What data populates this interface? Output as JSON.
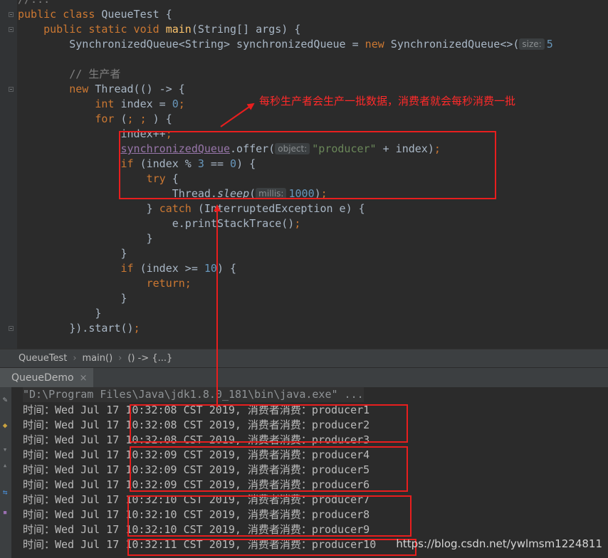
{
  "editor": {
    "lines": [
      [
        [
          "cm",
          "//..."
        ]
      ],
      [
        [
          "kw",
          "public class "
        ],
        [
          "p",
          "QueueTest {"
        ]
      ],
      [
        [
          "p",
          "    "
        ],
        [
          "kw",
          "public static void "
        ],
        [
          "fn",
          "main"
        ],
        [
          "p",
          "(String[] args) {"
        ]
      ],
      [
        [
          "p",
          "        SynchronizedQueue<String> synchronizedQueue = "
        ],
        [
          "kw",
          "new "
        ],
        [
          "p",
          "SynchronizedQueue<>("
        ],
        [
          "hint",
          "size:"
        ],
        [
          "num",
          "5"
        ]
      ],
      [
        [
          "p",
          ""
        ]
      ],
      [
        [
          "cm",
          "        // 生产者"
        ]
      ],
      [
        [
          "kw",
          "        new "
        ],
        [
          "p",
          "Thread(() -> {"
        ]
      ],
      [
        [
          "kw",
          "            int "
        ],
        [
          "p",
          "index = "
        ],
        [
          "num",
          "0"
        ],
        [
          "kw",
          ";"
        ]
      ],
      [
        [
          "kw",
          "            for "
        ],
        [
          "p",
          "("
        ],
        [
          "kw",
          "; ; "
        ],
        [
          "p",
          ") {"
        ]
      ],
      [
        [
          "p",
          "                index++"
        ],
        [
          "kw",
          ";"
        ]
      ],
      [
        [
          "p",
          "                "
        ],
        [
          "field",
          "synchronizedQueue"
        ],
        [
          "p",
          ".offer("
        ],
        [
          "hint",
          "object:"
        ],
        [
          "str",
          "\"producer\""
        ],
        [
          "p",
          " + index)"
        ],
        [
          "kw",
          ";"
        ]
      ],
      [
        [
          "kw",
          "                if "
        ],
        [
          "p",
          "(index % "
        ],
        [
          "num",
          "3"
        ],
        [
          "p",
          " == "
        ],
        [
          "num",
          "0"
        ],
        [
          "p",
          ") {"
        ]
      ],
      [
        [
          "kw",
          "                    try "
        ],
        [
          "p",
          "{"
        ]
      ],
      [
        [
          "p",
          "                        Thread."
        ],
        [
          "it",
          "sleep"
        ],
        [
          "p",
          "("
        ],
        [
          "hint",
          "millis:"
        ],
        [
          "num",
          "1000"
        ],
        [
          "p",
          ")"
        ],
        [
          "kw",
          ";"
        ]
      ],
      [
        [
          "p",
          "                    } "
        ],
        [
          "kw",
          "catch "
        ],
        [
          "p",
          "(InterruptedException e) {"
        ]
      ],
      [
        [
          "p",
          "                        e.printStackTrace()"
        ],
        [
          "kw",
          ";"
        ]
      ],
      [
        [
          "p",
          "                    }"
        ]
      ],
      [
        [
          "p",
          "                }"
        ]
      ],
      [
        [
          "kw",
          "                if "
        ],
        [
          "p",
          "(index >= "
        ],
        [
          "num",
          "10"
        ],
        [
          "p",
          ") {"
        ]
      ],
      [
        [
          "kw",
          "                    return;"
        ]
      ],
      [
        [
          "p",
          "                }"
        ]
      ],
      [
        [
          "p",
          "            }"
        ]
      ],
      [
        [
          "p",
          "        }).start()"
        ],
        [
          "kw",
          ";"
        ]
      ]
    ],
    "fold_markers": [
      1,
      2,
      6,
      22
    ]
  },
  "annotation": {
    "note": "每秒生产者会生产一批数据，消费者就会每秒消费一批",
    "color": "#e81e1e"
  },
  "breadcrumb": {
    "items": [
      "QueueTest",
      "main()",
      "() -> {...}"
    ]
  },
  "run_tab": {
    "label": "QueueDemo",
    "close": "×"
  },
  "console": {
    "command": "\"D:\\Program Files\\Java\\jdk1.8.0_181\\bin\\java.exe\" ...",
    "lines": [
      "时间：Wed Jul 17 10:32:08 CST 2019, 消费者消费：producer1",
      "时间：Wed Jul 17 10:32:08 CST 2019, 消费者消费：producer2",
      "时间：Wed Jul 17 10:32:08 CST 2019, 消费者消费：producer3",
      "时间：Wed Jul 17 10:32:09 CST 2019, 消费者消费：producer4",
      "时间：Wed Jul 17 10:32:09 CST 2019, 消费者消费：producer5",
      "时间：Wed Jul 17 10:32:09 CST 2019, 消费者消费：producer6",
      "时间：Wed Jul 17 10:32:10 CST 2019, 消费者消费：producer7",
      "时间：Wed Jul 17 10:32:10 CST 2019, 消费者消费：producer8",
      "时间：Wed Jul 17 10:32:10 CST 2019, 消费者消费：producer9",
      "时间：Wed Jul 17 10:32:11 CST 2019, 消费者消费：producer10"
    ]
  },
  "watermark": "https://blog.csdn.net/ywlmsm1224811",
  "colors": {
    "editor_bg": "#2b2b2b",
    "keyword": "#cc7832",
    "function": "#ffc66d",
    "number": "#6897bb",
    "string": "#6a8759",
    "comment": "#808080",
    "field": "#9876aa",
    "text": "#a9b7c6"
  }
}
